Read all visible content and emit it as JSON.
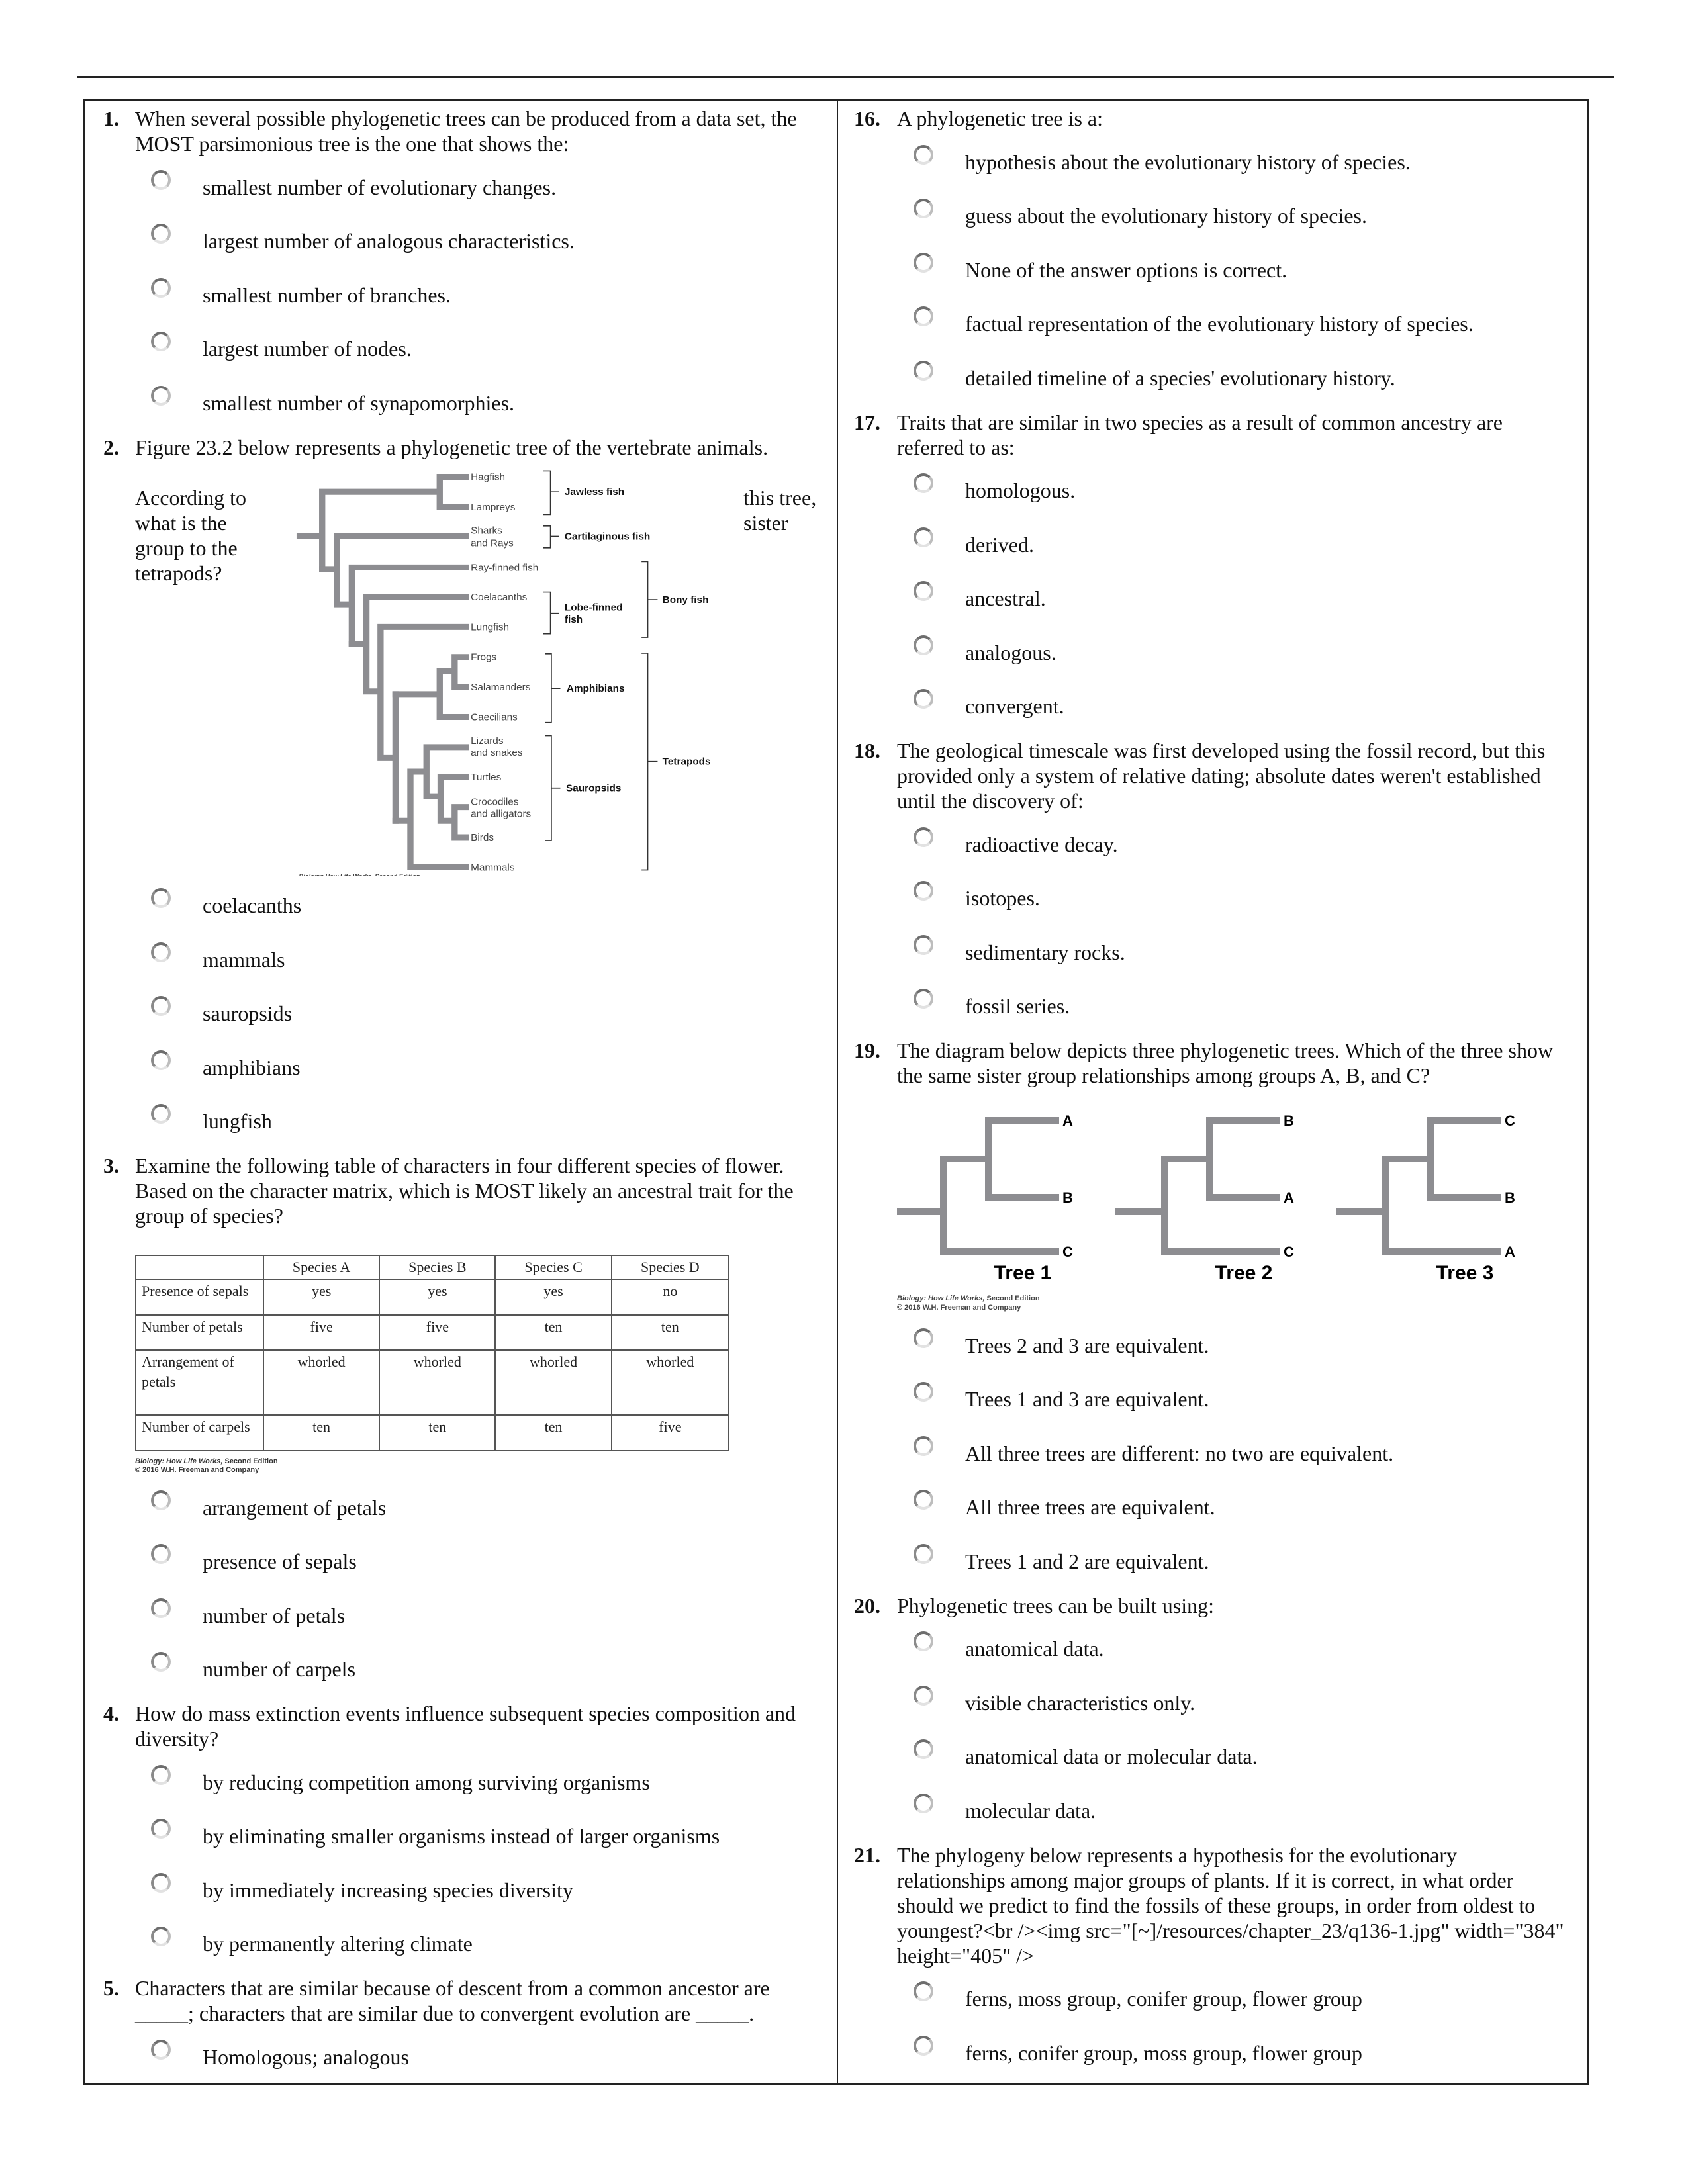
{
  "col1": [
    {
      "num": "1.",
      "text": "When several possible phylogenetic trees can be produced from a data set, the MOST parsimonious tree is the one that shows the:",
      "options": [
        "smallest number of evolutionary changes.",
        "largest number of analogous characteristics.",
        "smallest number of branches.",
        "largest number of nodes.",
        "smallest number of synapomorphies."
      ]
    },
    {
      "num": "2.",
      "text": "Figure 23.2 below represents a phylogenetic tree of the vertebrate animals.",
      "side_left": "According to what is the group to the tetrapods?",
      "side_right": "this tree, sister",
      "options": [
        "coelacanths",
        "mammals",
        "sauropsids",
        "amphibians",
        "lungfish"
      ]
    },
    {
      "num": "3.",
      "text": "Examine the following table of characters in four different species of flower. Based on the character matrix, which is MOST likely an ancestral trait for the group of species?",
      "options": [
        "arrangement of petals",
        "presence of sepals",
        "number of petals",
        "number of carpels"
      ]
    },
    {
      "num": "4.",
      "text": "How do mass extinction events influence subsequent species composition and diversity?",
      "options": [
        "by reducing competition among surviving organisms",
        "by eliminating smaller organisms instead of larger organisms",
        "by immediately increasing species diversity",
        "by permanently altering climate"
      ]
    },
    {
      "num": "5.",
      "text": "Characters that are similar because of descent from a common ancestor are _____; characters that are similar due to convergent evolution are _____.",
      "options": [
        "Homologous; analogous"
      ]
    }
  ],
  "col2": [
    {
      "num": "16.",
      "text": "A phylogenetic tree is a:",
      "options": [
        "hypothesis about the evolutionary history of species.",
        "guess about the evolutionary history of species.",
        "None of the answer options is correct.",
        "factual representation of the evolutionary history of species.",
        "detailed timeline of a species' evolutionary history."
      ]
    },
    {
      "num": "17.",
      "text": "Traits that are similar in two species as a result of common ancestry are referred to as:",
      "options": [
        "homologous.",
        "derived.",
        "ancestral.",
        "analogous.",
        "convergent."
      ]
    },
    {
      "num": "18.",
      "text": "The geological timescale was first developed using the fossil record, but this provided only a system of relative dating; absolute dates weren't established until the discovery of:",
      "options": [
        "radioactive decay.",
        "isotopes.",
        "sedimentary rocks.",
        "fossil series."
      ]
    },
    {
      "num": "19.",
      "text": "The diagram below depicts three phylogenetic trees. Which of the three show the same sister group relationships among groups A, B, and C?",
      "options": [
        "Trees 2 and 3 are equivalent.",
        "Trees 1 and 3 are equivalent.",
        "All three trees are different: no two are equivalent.",
        "All three trees are equivalent.",
        "Trees 1 and 2 are equivalent."
      ]
    },
    {
      "num": "20.",
      "text": "Phylogenetic trees can be built using:",
      "options": [
        "anatomical data.",
        "visible characteristics only.",
        "anatomical data or molecular data.",
        "molecular data."
      ]
    },
    {
      "num": "21.",
      "text": "The phylogeny below represents a hypothesis for the evolutionary relationships among major groups of plants. If it is correct, in what order should we predict to find the fossils of these groups, in order from oldest to youngest?<br /><img src=\"[~]/resources/chapter_23/q136-1.jpg\" width=\"384\" height=\"405\" />",
      "options": [
        "ferns, moss group, conifer group, flower group",
        "ferns, conifer group, moss group, flower group"
      ]
    }
  ],
  "vertebrate_tree": {
    "taxa": [
      "Hagfish",
      "Lampreys",
      "Sharks",
      "and Rays",
      "Ray-finned fish",
      "Coelacanths",
      "Lungfish",
      "Frogs",
      "Salamanders",
      "Caecilians",
      "Lizards",
      "and snakes",
      "Turtles",
      "Crocodiles",
      "and alligators",
      "Birds",
      "Mammals"
    ],
    "groups": [
      "Jawless fish",
      "Cartilaginous fish",
      "Lobe-finned",
      "fish",
      "Bony fish",
      "Amphibians",
      "Sauropsids",
      "Tetrapods"
    ],
    "branch_color": "#8d8d91"
  },
  "credit": {
    "title": "Biology: How Life Works,",
    "edition": " Second Edition",
    "copyright": "© 2016 W.H. Freeman and Company"
  },
  "character_table": {
    "headers": [
      "",
      "Species A",
      "Species B",
      "Species C",
      "Species D"
    ],
    "rows": [
      [
        "Presence of sepals",
        "yes",
        "yes",
        "yes",
        "no"
      ],
      [
        "Number of petals",
        "five",
        "five",
        "ten",
        "ten"
      ],
      [
        "Arrangement of petals",
        "whorled",
        "whorled",
        "whorled",
        "whorled"
      ],
      [
        "Number of carpels",
        "ten",
        "ten",
        "ten",
        "five"
      ]
    ]
  },
  "abc_trees": {
    "trees": [
      {
        "label": "Tree 1",
        "tips": [
          "A",
          "B",
          "C"
        ]
      },
      {
        "label": "Tree 2",
        "tips": [
          "B",
          "A",
          "C"
        ]
      },
      {
        "label": "Tree 3",
        "tips": [
          "C",
          "B",
          "A"
        ]
      }
    ]
  }
}
